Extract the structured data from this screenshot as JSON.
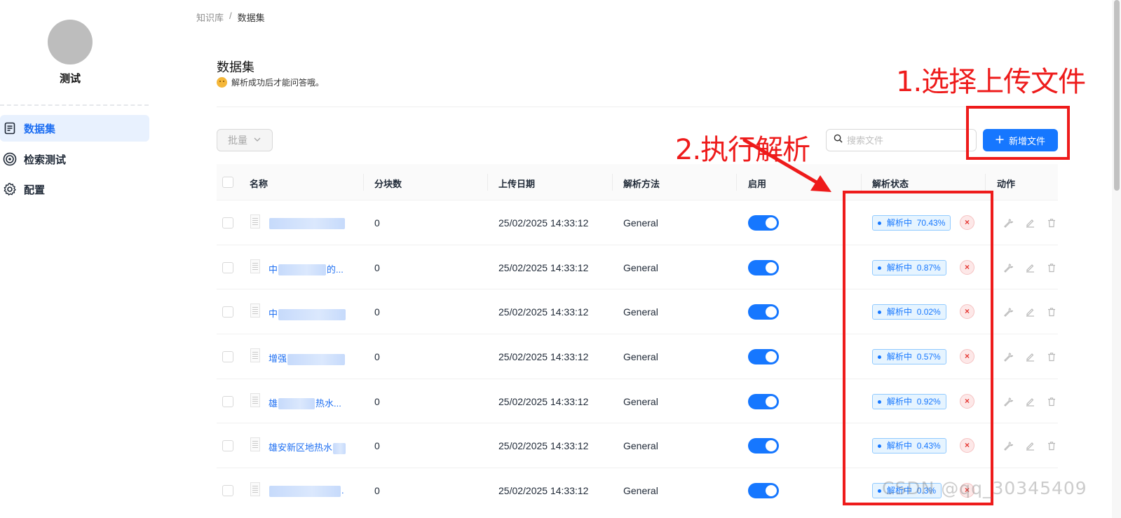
{
  "sidebar": {
    "kb_name": "测试",
    "items": [
      {
        "label": "数据集",
        "icon": "document-icon",
        "active": true
      },
      {
        "label": "检索测试",
        "icon": "target-icon",
        "active": false
      },
      {
        "label": "配置",
        "icon": "gear-icon",
        "active": false
      }
    ]
  },
  "breadcrumb": {
    "parent": "知识库",
    "separator": "/",
    "current": "数据集"
  },
  "header": {
    "title": "数据集",
    "subtitle": "解析成功后才能问答哦。"
  },
  "toolbar": {
    "bulk_label": "批量",
    "search_placeholder": "搜索文件",
    "add_label": "新增文件"
  },
  "table": {
    "columns": [
      "名称",
      "分块数",
      "上传日期",
      "解析方法",
      "启用",
      "解析状态",
      "动作"
    ],
    "rows": [
      {
        "name_visible": "",
        "chunks": "0",
        "date": "25/02/2025 14:33:12",
        "method": "General",
        "enabled": true,
        "status": "解析中",
        "progress": "70.43%"
      },
      {
        "name_visible": "中",
        "name_tail": "的...",
        "chunks": "0",
        "date": "25/02/2025 14:33:12",
        "method": "General",
        "enabled": true,
        "status": "解析中",
        "progress": "0.87%"
      },
      {
        "name_visible": "中",
        "name_tail": "",
        "chunks": "0",
        "date": "25/02/2025 14:33:12",
        "method": "General",
        "enabled": true,
        "status": "解析中",
        "progress": "0.02%"
      },
      {
        "name_visible": "增强",
        "name_tail": "",
        "chunks": "0",
        "date": "25/02/2025 14:33:12",
        "method": "General",
        "enabled": true,
        "status": "解析中",
        "progress": "0.57%"
      },
      {
        "name_visible": "雄",
        "name_tail": "热水...",
        "chunks": "0",
        "date": "25/02/2025 14:33:12",
        "method": "General",
        "enabled": true,
        "status": "解析中",
        "progress": "0.92%"
      },
      {
        "name_visible": "雄安新区地热水",
        "name_tail": "",
        "chunks": "0",
        "date": "25/02/2025 14:33:12",
        "method": "General",
        "enabled": true,
        "status": "解析中",
        "progress": "0.43%"
      },
      {
        "name_visible": "",
        "name_tail": ".",
        "chunks": "0",
        "date": "25/02/2025 14:33:12",
        "method": "General",
        "enabled": true,
        "status": "解析中",
        "progress": "0.3%"
      }
    ]
  },
  "annotations": {
    "step1": "1.选择上传文件",
    "step2": "2.执行解析",
    "color": "#ee1b1b"
  },
  "watermark": "CSDN @qq_30345409",
  "colors": {
    "accent": "#1677ff",
    "active_nav_bg": "#e8f1fe",
    "status_bg": "#e6f4ff"
  }
}
